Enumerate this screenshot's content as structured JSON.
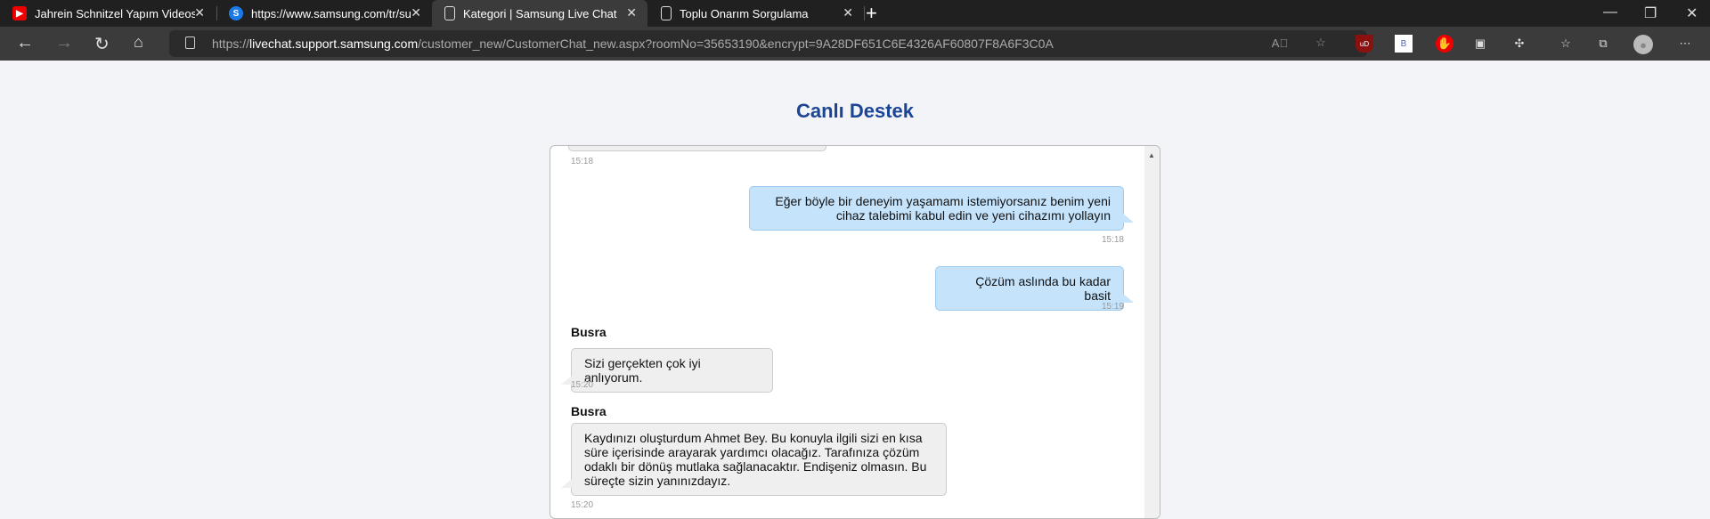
{
  "browser": {
    "tabs": [
      {
        "title": "Jahrein Schnitzel Yapım Videosu",
        "icon": "youtube-icon"
      },
      {
        "title": "https://www.samsung.com/tr/sup",
        "icon": "samsung-icon"
      },
      {
        "title": "Kategori | Samsung Live Chat",
        "icon": "page-icon",
        "active": true
      },
      {
        "title": "Toplu Onarım Sorgulama",
        "icon": "page-icon"
      }
    ],
    "url_prefix": "https://",
    "url_host": "livechat.support.samsung.com",
    "url_path": "/customer_new/CustomerChat_new.aspx?roomNo=35653190&encrypt=9A28DF651C6E4326AF60807F8A6F3C0A",
    "extensions": {
      "udblock": "uD",
      "b": "B"
    }
  },
  "page": {
    "title": "Canlı Destek"
  },
  "chat": {
    "messages": [
      {
        "side": "agent",
        "text": "",
        "time": "15:18"
      },
      {
        "side": "user",
        "text": "Eğer böyle bir deneyim yaşamamı istemiyorsanız benim yeni cihaz talebimi kabul edin ve yeni cihazımı yollayın",
        "time": "15:18"
      },
      {
        "side": "user",
        "text": "Çözüm aslında bu kadar basit",
        "time": "15:19"
      },
      {
        "side": "agent",
        "name": "Busra",
        "text": "Sizi gerçekten çok iyi anlıyorum.",
        "time": "15:20"
      },
      {
        "side": "agent",
        "name": "Busra",
        "text": "Kaydınızı oluşturdum Ahmet Bey. Bu konuyla ilgili sizi en kısa süre içerisinde arayarak yardımcı olacağız. Tarafınıza çözüm odaklı bir dönüş mutlaka sağlanacaktır. Endişeniz olmasın. Bu süreçte sizin yanınızdayız.",
        "time": "15:20"
      }
    ]
  }
}
